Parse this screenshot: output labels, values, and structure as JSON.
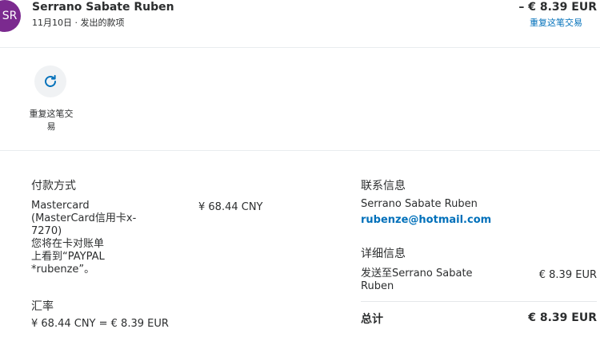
{
  "header": {
    "avatar_initials": "SR",
    "name": "Serrano Sabate Ruben",
    "subtitle": "11月10日 · 发出的款项",
    "amount": "– € 8.39 EUR",
    "repeat_link": "重复这笔交易"
  },
  "actions": {
    "repeat_label": "重复这笔交易",
    "repeat_icon": "refresh-icon"
  },
  "payment": {
    "title": "付款方式",
    "method_lines": [
      "Mastercard",
      "(MasterCard信用卡x-",
      "7270)",
      "您将在卡对账单",
      "上看到“PAYPAL",
      "*rubenze”。"
    ],
    "amount": "¥ 68.44 CNY"
  },
  "exchange": {
    "title": "汇率",
    "line1": "¥ 68.44 CNY = € 8.39 EUR"
  },
  "contact": {
    "title": "联系信息",
    "name": "Serrano Sabate Ruben",
    "email": "rubenze@hotmail.com"
  },
  "details": {
    "title": "详细信息",
    "sent_to_lines": [
      "发送至Serrano Sabate",
      "Ruben"
    ],
    "sent_amount": "€ 8.39 EUR",
    "total_label": "总计",
    "total_amount": "€ 8.39 EUR"
  },
  "colors": {
    "avatar": "#7b2a8f",
    "link": "#0070ba"
  }
}
